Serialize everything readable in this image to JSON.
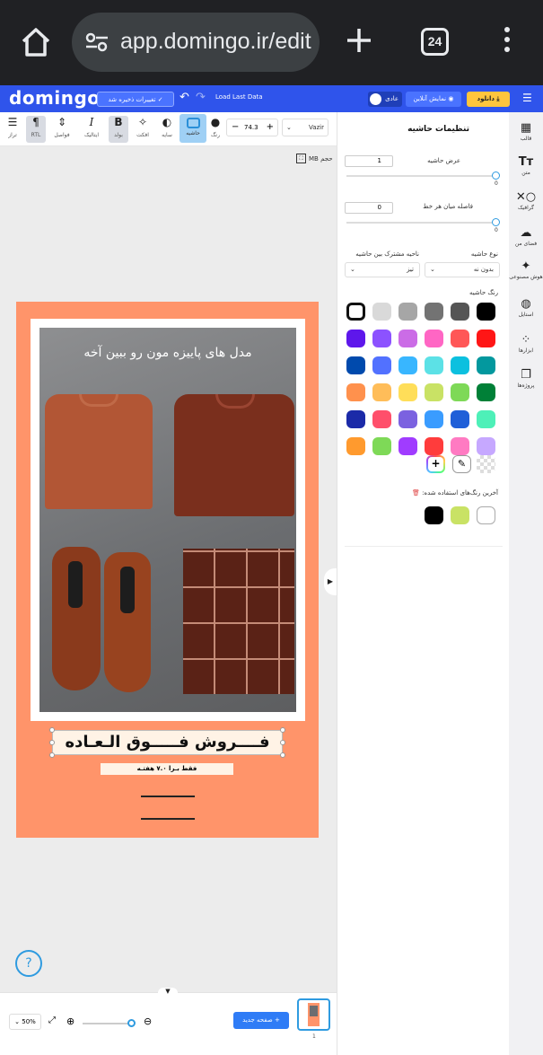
{
  "browser": {
    "url": "app.domingo.ir/edit",
    "tab_count": "24"
  },
  "app": {
    "logo": "domingo",
    "saved_label": "تغییرات ذخیره شد",
    "load_last_label": "Load Last Data",
    "mode_label": "عادی",
    "preview_label": "نمایش آنلاین",
    "download_label": "دانلود"
  },
  "toolbar": {
    "align": "تراز",
    "rtl": "RTL",
    "spacing": "فواصل",
    "italic": "ایتالیک",
    "bold": "بولد",
    "effect": "افکت",
    "shadow": "سایه",
    "border": "حاشیه",
    "color": "رنگ",
    "font_size": "74.3",
    "font": "Vazir"
  },
  "canvas": {
    "size_label": "حجم",
    "size_unit": "MB",
    "photo_caption": "مدل های پاییزه مون رو ببین آخه",
    "headline": "فــــروش فـــــوق الـعـاده",
    "subline": "فقط بـرا ۷.۰ هفتـه"
  },
  "bottom": {
    "zoom": "50%",
    "new_page": "صفحه جدید",
    "page_number": "1"
  },
  "panel": {
    "title": "تنظیمات حاشیه",
    "border_width_label": "عرض حاشیه",
    "border_width_value": "1",
    "border_width_min": "0",
    "line_spacing_label": "فاصله میان هر خط",
    "line_spacing_value": "0",
    "line_spacing_min": "0",
    "border_type_label": "نوع حاشیه",
    "border_type_value": "بدون نه",
    "shared_area_label": "ناحیه مشترک بین حاشیه",
    "shared_area_value": "تیز",
    "border_color_label": "رنگ حاشیه",
    "recent_colors_label": "آخرین رنگ‌های استفاده شده:"
  },
  "swatches": [
    [
      "#000000",
      "#555555",
      "#737373",
      "#a6a6a6",
      "#d9d9d9",
      "#ffffff"
    ],
    [
      "#ff1616",
      "#ff5757",
      "#ff66c4",
      "#cb6ce6",
      "#8c52ff",
      "#5e17eb"
    ],
    [
      "#03989e",
      "#0cc0df",
      "#5ce1e6",
      "#38b6ff",
      "#5271ff",
      "#004aad"
    ],
    [
      "#008037",
      "#7ed957",
      "#c9e265",
      "#ffde59",
      "#ffbd59",
      "#ff914d"
    ],
    [
      "#4ef0b8",
      "#1f5fd8",
      "#3a9cff",
      "#7b62e0",
      "#ff4f6b",
      "#1b2aa8"
    ],
    [
      "#c6a8ff",
      "#ff7ac2",
      "#ff3c3c",
      "#a03cff",
      "#7ed957",
      "#ff9a2e"
    ]
  ],
  "recent_colors": [
    "#ffffff",
    "#c9e265",
    "#000000"
  ],
  "sidebar": {
    "template": "قالب",
    "text": "متن",
    "graphic": "گرافیک",
    "my_space": "فضای من",
    "ai": "هوش مصنوعی",
    "style": "استایل",
    "tools": "ابزارها",
    "projects": "پروژه‌ها"
  },
  "colors": {
    "brand": "#2f54eb",
    "accent": "#2f9be0",
    "design_bg": "#ff946a",
    "download": "#ffc53d"
  }
}
